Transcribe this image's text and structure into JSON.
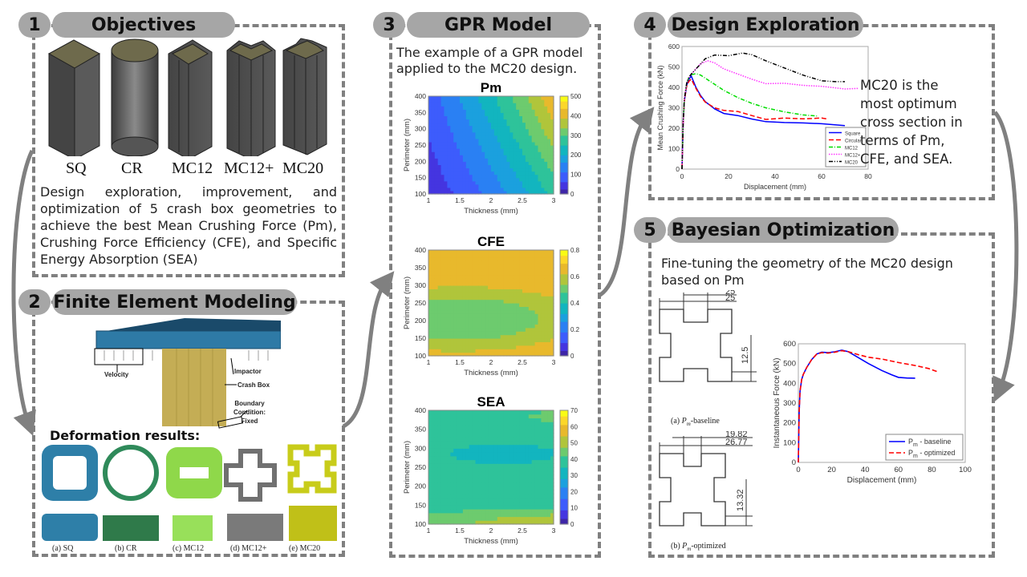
{
  "panels": {
    "p1": {
      "number": "1",
      "title": "Objectives",
      "shapes": [
        "SQ",
        "CR",
        "MC12",
        "MC12+",
        "MC20"
      ],
      "description": "Design exploration, improvement, and optimization of 5 crash box geometries to achieve the best Mean Crushing Force (Pm), Crushing Force Efficiency (CFE), and Specific Energy Absorption (SEA)"
    },
    "p2": {
      "number": "2",
      "title": "Finite Element Modeling",
      "fe_labels": {
        "velocity": "Velocity",
        "impactor": "Impactor",
        "crash_box": "Crash Box",
        "boundary": "Boundary Condition: Fixed"
      },
      "deformation_title": "Deformation results:",
      "deformation_captions": [
        "(a) SQ",
        "(b) CR",
        "(c) MC12",
        "(d) MC12+",
        "(e) MC20"
      ],
      "colors": {
        "SQ": "#2e7fa8",
        "CR": "#2f8a5a",
        "MC12": "#8fd84a",
        "MC12+": "#707070",
        "MC20": "#c8cc1a"
      }
    },
    "p3": {
      "number": "3",
      "title": "GPR Model",
      "description": "The example of a GPR model applied to the MC20 design."
    },
    "p4": {
      "number": "4",
      "title": "Design Exploration",
      "conclusion": "MC20 is the most optimum cross section in terms of Pm, CFE, and SEA."
    },
    "p5": {
      "number": "5",
      "title": "Bayesian Optimization",
      "description": "Fine-tuning the geometry of the MC20 design based on Pm",
      "baseline": {
        "dims": [
          "25",
          "25",
          "12.5"
        ],
        "caption_pre": "(a) ",
        "caption_sym": "P",
        "caption_sub": "m",
        "caption_post": "-baseline"
      },
      "optimized": {
        "dims": [
          "19.82",
          "26.77",
          "13.32"
        ],
        "caption_pre": "(b) ",
        "caption_sym": "P",
        "caption_sub": "m",
        "caption_post": "-optimized"
      }
    }
  },
  "chart_data": [
    {
      "id": "pm-contour",
      "type": "heatmap",
      "title": "Pm",
      "xlabel": "Thickness (mm)",
      "ylabel": "Perimeter (mm)",
      "xlim": [
        1,
        3
      ],
      "ylim": [
        100,
        400
      ],
      "xticks": [
        "1",
        "1.5",
        "2",
        "2.5",
        "3"
      ],
      "yticks": [
        "100",
        "150",
        "200",
        "250",
        "300",
        "350",
        "400"
      ],
      "colorbar": {
        "min": 0,
        "max": 500,
        "ticks": [
          "0",
          "100",
          "200",
          "300",
          "400",
          "500"
        ]
      },
      "trend": "increases with thickness and perimeter; ~20 at (1,100) to ~380 at (3,400)"
    },
    {
      "id": "cfe-contour",
      "type": "heatmap",
      "title": "CFE",
      "xlabel": "Thickness (mm)",
      "ylabel": "Perimeter (mm)",
      "xlim": [
        1,
        3
      ],
      "ylim": [
        100,
        400
      ],
      "xticks": [
        "1",
        "1.5",
        "2",
        "2.5",
        "3"
      ],
      "yticks": [
        "100",
        "150",
        "200",
        "250",
        "300",
        "350",
        "400"
      ],
      "colorbar": {
        "min": 0,
        "max": 0.8,
        "ticks": [
          "0",
          "0.2",
          "0.4",
          "0.6",
          "0.8"
        ]
      },
      "trend": "minimum ~0.5 near (1.5,200); ~0.65 at edges (perimeter 100 and 400)"
    },
    {
      "id": "sea-contour",
      "type": "heatmap",
      "title": "SEA",
      "xlabel": "Thickness (mm)",
      "ylabel": "Perimeter (mm)",
      "xlim": [
        1,
        3
      ],
      "ylim": [
        100,
        400
      ],
      "xticks": [
        "1",
        "1.5",
        "2",
        "2.5",
        "3"
      ],
      "yticks": [
        "100",
        "150",
        "200",
        "250",
        "300",
        "350",
        "400"
      ],
      "colorbar": {
        "min": 0,
        "max": 70,
        "ticks": [
          "0",
          "10",
          "20",
          "30",
          "40",
          "50",
          "60",
          "70"
        ]
      },
      "trend": "minimum ~30 near (2.3,290); maximum ~55 near (2.8,110)"
    },
    {
      "id": "design-exploration",
      "type": "line",
      "xlabel": "Displacement (mm)",
      "ylabel": "Mean Crushing Force (kN)",
      "xlim": [
        0,
        80
      ],
      "ylim": [
        0,
        600
      ],
      "xticks": [
        "0",
        "20",
        "40",
        "60",
        "80"
      ],
      "yticks": [
        "0",
        "100",
        "200",
        "300",
        "400",
        "500",
        "600"
      ],
      "legend": "bottom-right",
      "series": [
        {
          "name": "Square",
          "color": "#0000ff",
          "dash": "solid",
          "x": [
            0,
            0.5,
            1,
            2,
            3,
            4,
            6,
            8,
            10,
            14,
            18,
            24,
            30,
            36,
            44,
            52,
            60,
            70
          ],
          "y": [
            0,
            230,
            330,
            410,
            440,
            455,
            400,
            360,
            330,
            295,
            272,
            262,
            245,
            232,
            228,
            226,
            222,
            213
          ]
        },
        {
          "name": "Circular",
          "color": "#ff0000",
          "dash": "dashed",
          "x": [
            0,
            0.5,
            1,
            2,
            3,
            4,
            6,
            8,
            10,
            14,
            18,
            24,
            30,
            36,
            44,
            52,
            60,
            62
          ],
          "y": [
            0,
            230,
            330,
            405,
            430,
            440,
            395,
            355,
            328,
            300,
            287,
            282,
            262,
            243,
            250,
            246,
            250,
            246
          ]
        },
        {
          "name": "MC12",
          "color": "#00dd00",
          "dash": "dashdot",
          "x": [
            0,
            0.5,
            1,
            2,
            3,
            4,
            6,
            8,
            12,
            18,
            24,
            30,
            36,
            44,
            52,
            58
          ],
          "y": [
            0,
            230,
            340,
            420,
            450,
            462,
            467,
            460,
            430,
            385,
            350,
            322,
            300,
            280,
            265,
            260
          ]
        },
        {
          "name": "MC12+",
          "color": "#ff33ff",
          "dash": "dotted",
          "x": [
            0,
            0.5,
            1,
            2,
            3,
            4,
            6,
            8,
            11,
            14,
            18,
            24,
            30,
            36,
            44,
            52,
            60,
            70,
            76
          ],
          "y": [
            0,
            230,
            340,
            420,
            450,
            465,
            490,
            515,
            530,
            520,
            490,
            465,
            440,
            418,
            420,
            410,
            405,
            392,
            395
          ]
        },
        {
          "name": "MC20",
          "color": "#000000",
          "dash": "dashdotdot",
          "x": [
            0,
            0.5,
            1,
            2,
            3,
            4,
            6,
            8,
            10,
            14,
            20,
            26,
            30,
            36,
            44,
            52,
            60,
            66,
            70
          ],
          "y": [
            0,
            230,
            340,
            420,
            450,
            465,
            490,
            515,
            540,
            558,
            555,
            568,
            560,
            530,
            495,
            460,
            432,
            428,
            428
          ]
        }
      ]
    },
    {
      "id": "bayes-optimization",
      "type": "line",
      "xlabel": "Displacement (mm)",
      "ylabel": "Instantaneous Force (kN)",
      "xlim": [
        0,
        100
      ],
      "ylim": [
        0,
        600
      ],
      "xticks": [
        "0",
        "20",
        "40",
        "60",
        "80",
        "100"
      ],
      "yticks": [
        "0",
        "100",
        "200",
        "300",
        "400",
        "500",
        "600"
      ],
      "legend": "bottom-right",
      "series": [
        {
          "name": "Pm - baseline",
          "label_main": "P",
          "label_sub": "m",
          "label_post": " - baseline",
          "color": "#0000ff",
          "dash": "solid",
          "x": [
            0,
            0.5,
            1,
            2,
            3,
            5,
            8,
            11,
            14,
            18,
            22,
            26,
            30,
            36,
            42,
            50,
            56,
            60,
            65,
            70
          ],
          "y": [
            0,
            250,
            360,
            420,
            445,
            480,
            520,
            548,
            558,
            555,
            560,
            568,
            560,
            530,
            500,
            465,
            443,
            430,
            427,
            426
          ]
        },
        {
          "name": "Pm - optimized",
          "label_main": "P",
          "label_sub": "m",
          "label_post": " - optimized",
          "color": "#ff0000",
          "dash": "dashed",
          "x": [
            0,
            0.5,
            1,
            2,
            3,
            5,
            8,
            11,
            14,
            18,
            22,
            26,
            30,
            36,
            42,
            50,
            60,
            70,
            78,
            83
          ],
          "y": [
            0,
            250,
            360,
            420,
            445,
            480,
            520,
            548,
            555,
            553,
            558,
            565,
            560,
            545,
            532,
            523,
            505,
            490,
            475,
            460
          ]
        }
      ]
    }
  ]
}
